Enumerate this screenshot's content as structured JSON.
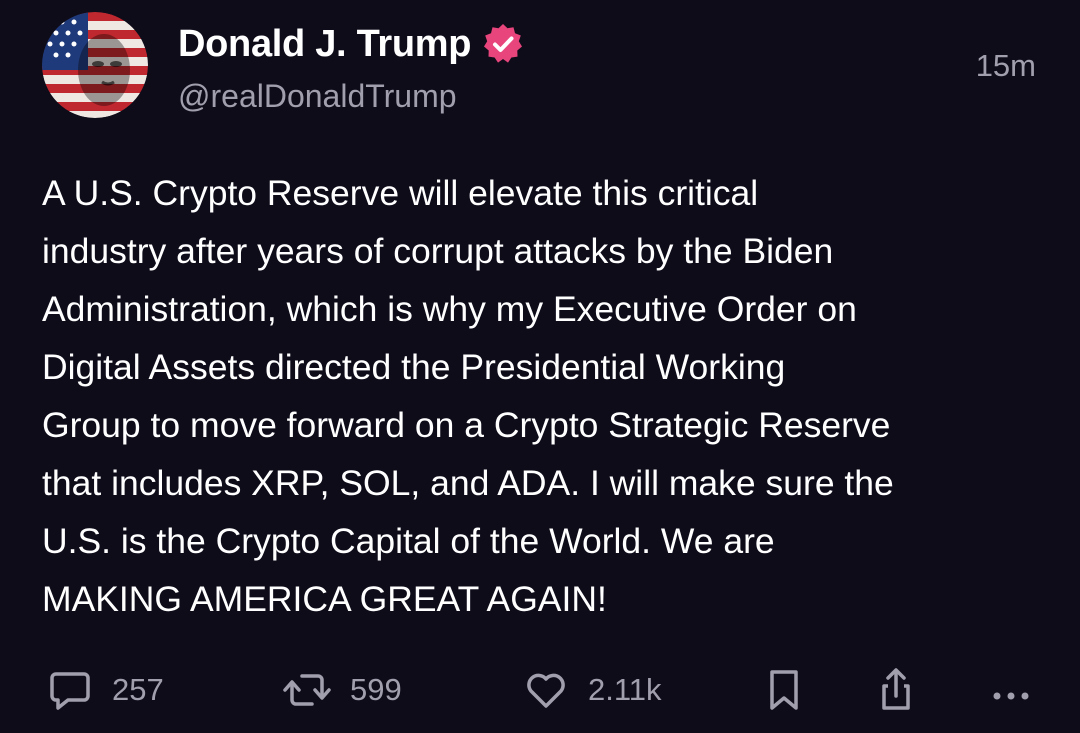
{
  "author": {
    "display_name": "Donald J. Trump",
    "handle": "@realDonaldTrump",
    "verified": true,
    "verified_color": "#e8457d"
  },
  "timestamp": "15m",
  "body_lines": [
    "A U.S. Crypto Reserve will elevate this critical",
    "industry after years of corrupt attacks by the Biden",
    "Administration, which is why my Executive Order on",
    "Digital Assets directed the Presidential Working",
    "Group to move forward on a Crypto Strategic Reserve",
    "that includes XRP, SOL, and ADA. I will make sure the",
    "U.S. is the Crypto Capital of the World. We are",
    "MAKING AMERICA GREAT AGAIN!"
  ],
  "actions": {
    "replies": "257",
    "reposts": "599",
    "likes": "2.11k"
  },
  "icons": {
    "reply": "speech-bubble-icon",
    "repost": "repost-arrows-icon",
    "like": "heart-icon",
    "bookmark": "bookmark-icon",
    "share": "share-icon",
    "more": "ellipsis-icon"
  },
  "colors": {
    "background": "#0f0c1a",
    "text": "#ffffff",
    "muted": "#a19fad"
  }
}
